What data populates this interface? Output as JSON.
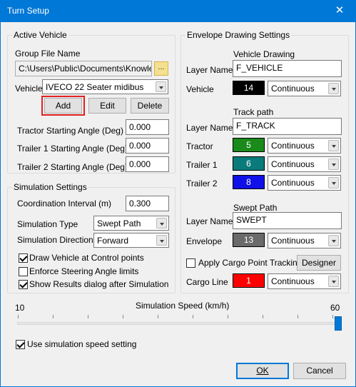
{
  "window": {
    "title": "Turn Setup"
  },
  "active_vehicle": {
    "group_title": "Active Vehicle",
    "group_file_label": "Group File Name",
    "group_file_value": "C:\\Users\\Public\\Documents\\Knowledge",
    "browse_label": "...",
    "vehicle_label": "Vehicle",
    "vehicle_value": "IVECO 22 Seater midibus",
    "add_label": "Add",
    "edit_label": "Edit",
    "delete_label": "Delete",
    "angles": [
      {
        "label": "Tractor  Starting Angle (Deg)",
        "value": "0.000"
      },
      {
        "label": "Trailer 1  Starting Angle (Deg)",
        "value": "0.000"
      },
      {
        "label": "Trailer 2  Starting Angle (Deg)",
        "value": "0.000"
      }
    ]
  },
  "simulation": {
    "group_title": "Simulation Settings",
    "coord_label": "Coordination Interval (m)",
    "coord_value": "0.300",
    "type_label": "Simulation Type",
    "type_value": "Swept Path",
    "direction_label": "Simulation Direction",
    "direction_value": "Forward",
    "checkboxes": [
      {
        "label": "Draw Vehicle at Control points",
        "checked": true
      },
      {
        "label": "Enforce Steering Angle limits",
        "checked": false
      },
      {
        "label": "Show Results dialog after Simulation",
        "checked": true
      }
    ]
  },
  "envelope": {
    "group_title": "Envelope Drawing Settings",
    "vehicle_heading": "Vehicle Drawing",
    "layer_name_label": "Layer Name",
    "vehicle_layer": "F_VEHICLE",
    "vehicle_label": "Vehicle",
    "vehicle_color": {
      "number": "14",
      "hex": "#000000"
    },
    "vehicle_linetype": "Continuous",
    "track_heading": "Track path",
    "track_layer": "F_TRACK",
    "tracks": [
      {
        "label": "Tractor",
        "number": "5",
        "hex": "#1a8a1a",
        "linetype": "Continuous"
      },
      {
        "label": "Trailer 1",
        "number": "6",
        "hex": "#0a7b7b",
        "linetype": "Continuous"
      },
      {
        "label": "Trailer 2",
        "number": "8",
        "hex": "#1010e8",
        "linetype": "Continuous"
      }
    ],
    "swept_heading": "Swept Path",
    "swept_layer": "SWEPT",
    "envelope_label": "Envelope",
    "envelope_color": {
      "number": "13",
      "hex": "#6a6a6a"
    },
    "envelope_linetype": "Continuous",
    "cargo_tracking_label": "Apply Cargo Point Tracking",
    "cargo_tracking_checked": false,
    "designer_label": "Designer",
    "cargo_line_label": "Cargo Line",
    "cargo_color": {
      "number": "1",
      "hex": "#ff0000"
    },
    "cargo_linetype": "Continuous"
  },
  "speed": {
    "label": "Simulation Speed (km/h)",
    "min": "10",
    "max": "60",
    "value": 60,
    "use_setting_label": "Use simulation speed setting",
    "use_setting_checked": true
  },
  "footer": {
    "ok_label": "OK",
    "cancel_label": "Cancel"
  }
}
